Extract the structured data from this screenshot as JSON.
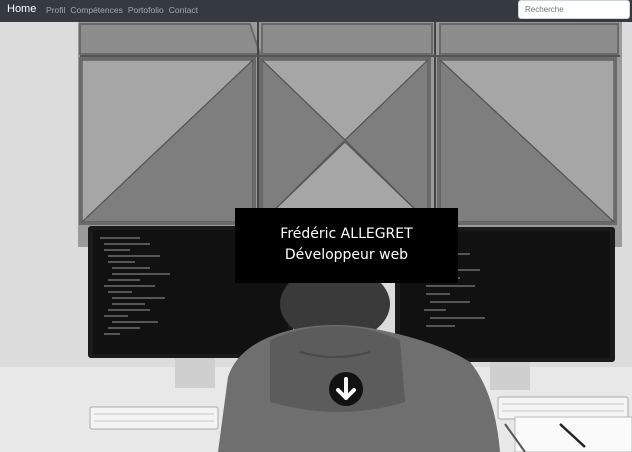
{
  "navbar": {
    "brand": "Home",
    "links": [
      "Profil",
      "Compétences",
      "Portofolio",
      "Contact"
    ],
    "search_placeholder": "Recherche"
  },
  "hero": {
    "name": "Frédéric ALLEGRET",
    "job_title": "Développeur web"
  },
  "colors": {
    "navbar_bg": "#343a40",
    "title_bg": "#000000",
    "title_text": "#ffffff"
  },
  "icons": {
    "scroll_down": "arrow-down-circle-icon"
  }
}
